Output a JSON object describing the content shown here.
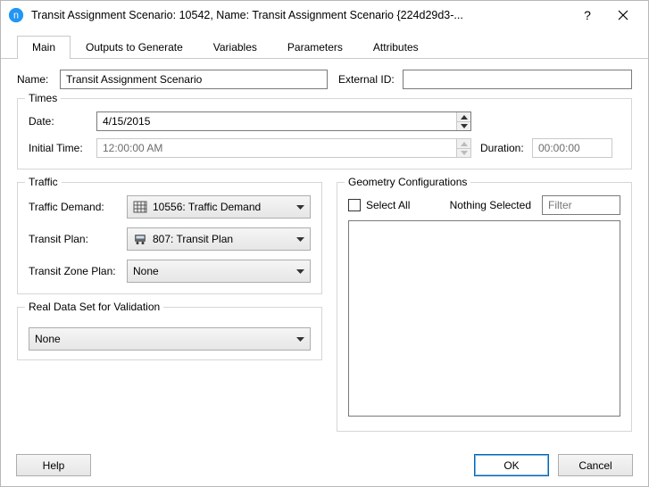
{
  "window": {
    "title": "Transit Assignment Scenario: 10542, Name: Transit Assignment Scenario  {224d29d3-...",
    "help_glyph": "?",
    "close_label": "Close"
  },
  "tabs": [
    {
      "label": "Main",
      "active": true
    },
    {
      "label": "Outputs to Generate",
      "active": false
    },
    {
      "label": "Variables",
      "active": false
    },
    {
      "label": "Parameters",
      "active": false
    },
    {
      "label": "Attributes",
      "active": false
    }
  ],
  "header": {
    "name_label": "Name:",
    "name_value": "Transit Assignment Scenario",
    "external_id_label": "External ID:",
    "external_id_value": ""
  },
  "times": {
    "legend": "Times",
    "date_label": "Date:",
    "date_value": "4/15/2015",
    "initial_time_label": "Initial Time:",
    "initial_time_value": "12:00:00 AM",
    "duration_label": "Duration:",
    "duration_value": "00:00:00"
  },
  "traffic": {
    "legend": "Traffic",
    "demand_label": "Traffic Demand:",
    "demand_value": "10556: Traffic Demand",
    "transit_plan_label": "Transit Plan:",
    "transit_plan_value": "807: Transit Plan",
    "transit_zone_label": "Transit Zone Plan:",
    "transit_zone_value": "None"
  },
  "validation": {
    "legend": "Real Data Set for Validation",
    "value": "None"
  },
  "geometry": {
    "legend": "Geometry Configurations",
    "select_all_label": "Select All",
    "nothing_selected": "Nothing Selected",
    "filter_placeholder": "Filter"
  },
  "footer": {
    "help": "Help",
    "ok": "OK",
    "cancel": "Cancel"
  }
}
